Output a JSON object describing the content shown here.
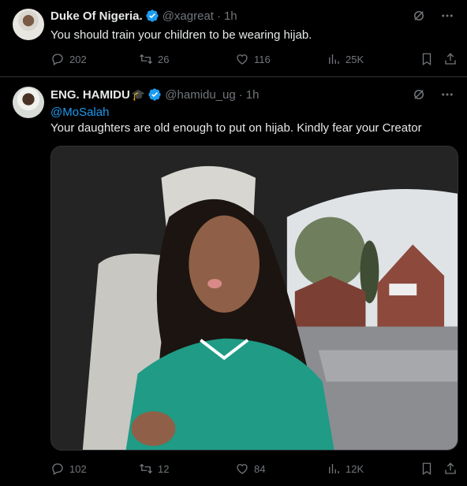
{
  "tweets": [
    {
      "name": "Duke Of Nigeria.",
      "handle": "@xagreat",
      "separator": "·",
      "time": "1h",
      "text": "You should train your children to be wearing hijab.",
      "stats": {
        "replies": "202",
        "reposts": "26",
        "likes": "116",
        "views": "25K"
      }
    },
    {
      "name": "ENG. HAMIDU",
      "badge_emoji": "🎓",
      "handle": "@hamidu_ug",
      "separator": "·",
      "time": "1h",
      "mention": "@MoSalah",
      "text": "Your daughters are old enough to put on hijab. Kindly fear your Creator",
      "stats": {
        "replies": "102",
        "reposts": "12",
        "likes": "84",
        "views": "12K"
      }
    }
  ],
  "colors": {
    "background": "#000000",
    "text": "#e7e9ea",
    "muted": "#71767b",
    "accent": "#1d9bf0",
    "divider": "#2f3336"
  },
  "icons": [
    "verified-badge-icon",
    "grok-icon",
    "more-icon",
    "reply-icon",
    "repost-icon",
    "like-icon",
    "views-icon",
    "bookmark-icon",
    "share-icon"
  ]
}
